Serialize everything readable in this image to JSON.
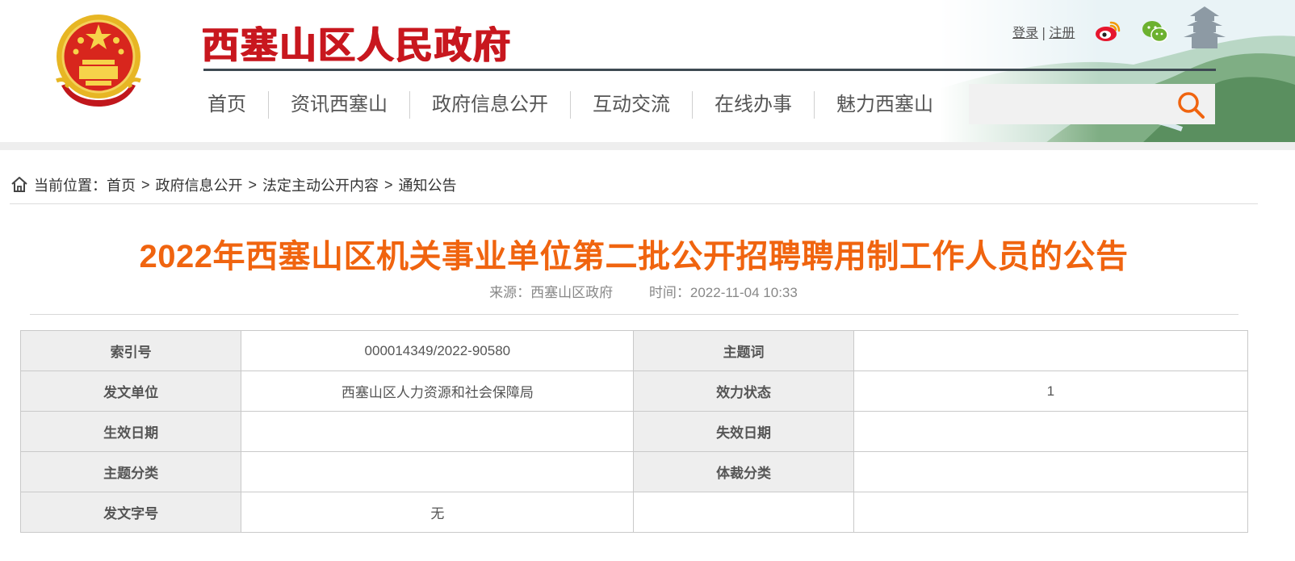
{
  "header": {
    "site_title": "西塞山区人民政府",
    "login_label": "登录",
    "separator": "|",
    "register_label": "注册",
    "nav": [
      {
        "label": "首页"
      },
      {
        "label": "资讯西塞山"
      },
      {
        "label": "政府信息公开"
      },
      {
        "label": "互动交流"
      },
      {
        "label": "在线办事"
      },
      {
        "label": "魅力西塞山"
      }
    ],
    "search": {
      "value": "",
      "placeholder": ""
    },
    "icons": {
      "emblem": "national-emblem",
      "weibo": "weibo-icon",
      "wechat": "wechat-icon",
      "search": "search-icon"
    },
    "colors": {
      "title_red": "#c8171e",
      "search_orange": "#f0640f"
    }
  },
  "breadcrumb": {
    "prefix": "当前位置：",
    "items": [
      "首页",
      "政府信息公开",
      "法定主动公开内容",
      "通知公告"
    ],
    "separator": ">"
  },
  "article": {
    "title": "2022年西塞山区机关事业单位第二批公开招聘聘用制工作人员的公告",
    "source": "来源：西塞山区政府",
    "time": "时间：2022-11-04 10:33",
    "title_color": "#f0640f"
  },
  "info_table": {
    "rows": [
      {
        "label1": "索引号",
        "value1": "000014349/2022-90580",
        "label2": "主题词",
        "value2": ""
      },
      {
        "label1": "发文单位",
        "value1": "西塞山区人力资源和社会保障局",
        "label2": "效力状态",
        "value2": "1"
      },
      {
        "label1": "生效日期",
        "value1": "",
        "label2": "失效日期",
        "value2": ""
      },
      {
        "label1": "主题分类",
        "value1": "",
        "label2": "体裁分类",
        "value2": ""
      },
      {
        "label1": "发文字号",
        "value1": "无",
        "label2": "",
        "value2": ""
      }
    ]
  }
}
